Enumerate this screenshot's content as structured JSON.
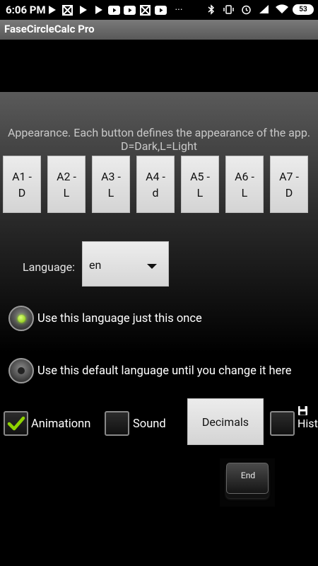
{
  "status_bar": {
    "time": "6:06 PM",
    "left_icons": [
      "play-store-icon",
      "delivery-icon",
      "play-store-icon",
      "play-store-icon",
      "youtube-icon",
      "youtube-icon",
      "delivery-icon",
      "youtube-icon",
      "more-icon"
    ],
    "more_label": "···",
    "battery": "53"
  },
  "app": {
    "title": "FaseCircleCalc Pro"
  },
  "appearance": {
    "description": "Appearance. Each button defines the appearance of the app. D=Dark,L=Light",
    "buttons": [
      {
        "label": "A1 -\nD"
      },
      {
        "label": "A2 -\nL"
      },
      {
        "label": "A3 -\nL"
      },
      {
        "label": "A4 -\nd"
      },
      {
        "label": "A5 -\nL"
      },
      {
        "label": "A6 -\nL"
      },
      {
        "label": "A7 -\nD"
      }
    ]
  },
  "language": {
    "label": "Language:",
    "selected": "en"
  },
  "language_mode": {
    "once_label": "Use this language just this once",
    "default_label": "Use this default language until you change it here",
    "selected": "once"
  },
  "options": {
    "animation_label": "Animationn",
    "animation_checked": true,
    "sound_label": "Sound",
    "sound_checked": false,
    "decimals_label": "Decimals",
    "hist_label": "Hist",
    "hist_checked": false
  },
  "end_key": {
    "label": "End"
  },
  "colors": {
    "accent_green": "#7fbf00",
    "title_bar": "#6a6a6a"
  }
}
